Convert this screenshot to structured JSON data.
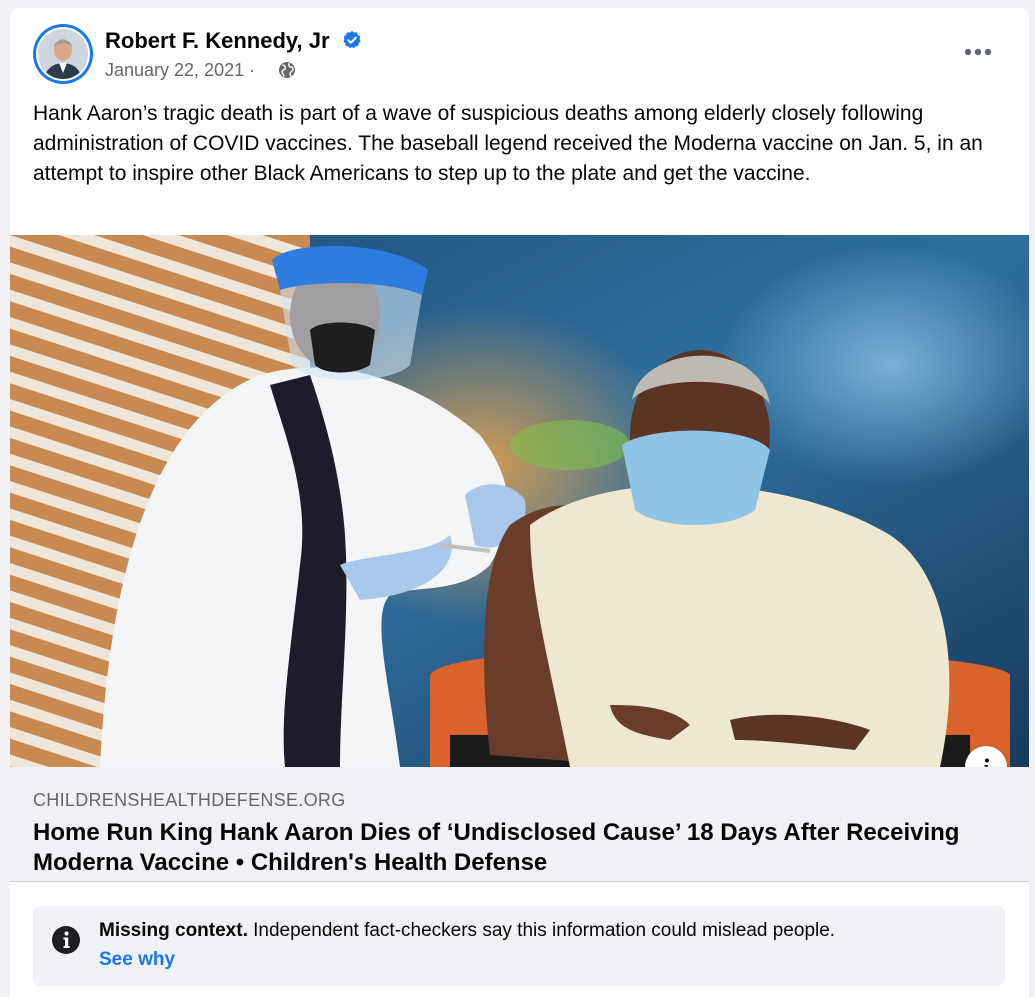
{
  "post": {
    "author": {
      "name": "Robert F. Kennedy, Jr",
      "verified_icon": "verified-badge-icon",
      "avatar_icon": "profile-photo"
    },
    "date": "January 22, 2021",
    "meta_separator": " · ",
    "audience_icon": "globe-icon",
    "menu_icon": "more-options-icon",
    "text": "Hank Aaron’s tragic death is part of a wave of suspicious deaths among elderly closely following administration of COVID vaccines. The baseball legend received the Moderna vaccine on Jan. 5, in an attempt to inspire other Black Americans to step up to the plate and get the vaccine."
  },
  "link_preview": {
    "domain": "CHILDRENSHEALTHDEFENSE.ORG",
    "title": "Home Run King Hank Aaron Dies of ‘Undisclosed Cause’ 18 Days After Receiving Moderna Vaccine • Children's Health Defense",
    "info_icon": "info-icon"
  },
  "fact_check": {
    "label": "Missing context.",
    "message": " Independent fact-checkers say this information could mislead people.",
    "link": "See why",
    "icon": "info-circle-icon"
  },
  "colors": {
    "accent": "#1877f2",
    "secondary_text": "#65676b",
    "primary_text": "#050505",
    "surface": "#f0f2f5"
  }
}
